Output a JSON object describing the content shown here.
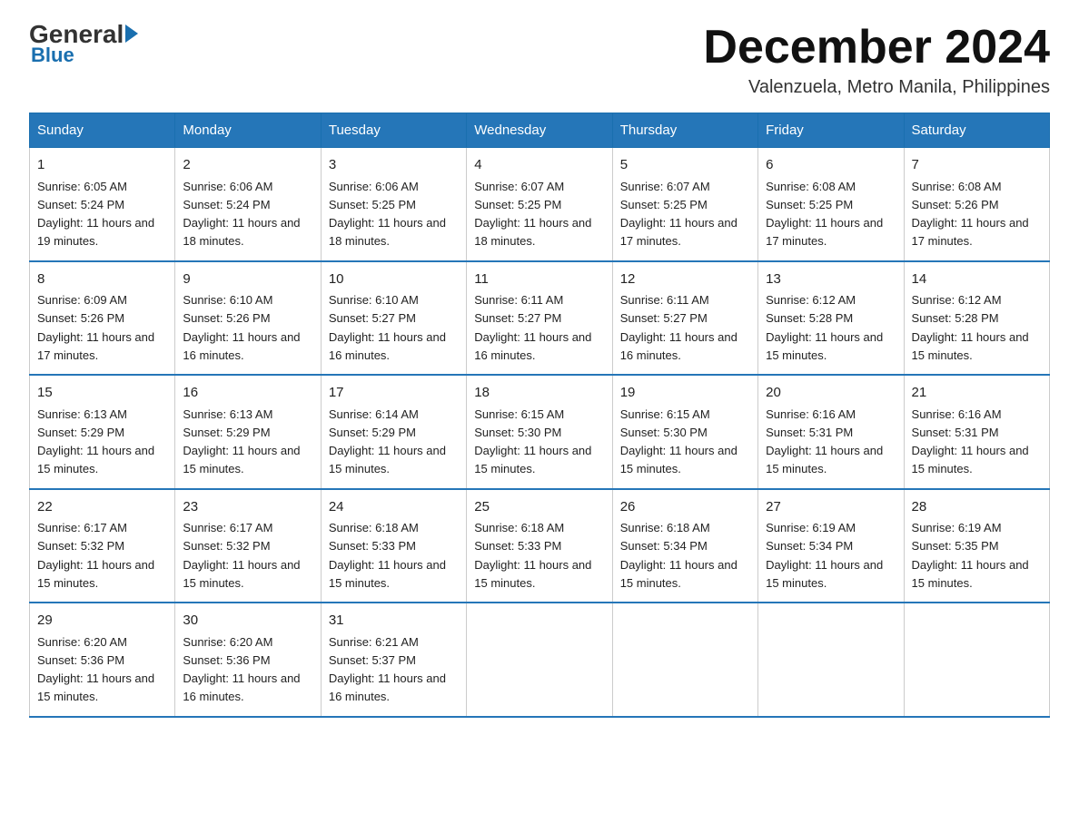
{
  "logo": {
    "general": "General",
    "arrow": "",
    "blue": "Blue"
  },
  "header": {
    "month_title": "December 2024",
    "location": "Valenzuela, Metro Manila, Philippines"
  },
  "weekdays": [
    "Sunday",
    "Monday",
    "Tuesday",
    "Wednesday",
    "Thursday",
    "Friday",
    "Saturday"
  ],
  "weeks": [
    [
      {
        "day": "1",
        "sunrise": "6:05 AM",
        "sunset": "5:24 PM",
        "daylight": "11 hours and 19 minutes."
      },
      {
        "day": "2",
        "sunrise": "6:06 AM",
        "sunset": "5:24 PM",
        "daylight": "11 hours and 18 minutes."
      },
      {
        "day": "3",
        "sunrise": "6:06 AM",
        "sunset": "5:25 PM",
        "daylight": "11 hours and 18 minutes."
      },
      {
        "day": "4",
        "sunrise": "6:07 AM",
        "sunset": "5:25 PM",
        "daylight": "11 hours and 18 minutes."
      },
      {
        "day": "5",
        "sunrise": "6:07 AM",
        "sunset": "5:25 PM",
        "daylight": "11 hours and 17 minutes."
      },
      {
        "day": "6",
        "sunrise": "6:08 AM",
        "sunset": "5:25 PM",
        "daylight": "11 hours and 17 minutes."
      },
      {
        "day": "7",
        "sunrise": "6:08 AM",
        "sunset": "5:26 PM",
        "daylight": "11 hours and 17 minutes."
      }
    ],
    [
      {
        "day": "8",
        "sunrise": "6:09 AM",
        "sunset": "5:26 PM",
        "daylight": "11 hours and 17 minutes."
      },
      {
        "day": "9",
        "sunrise": "6:10 AM",
        "sunset": "5:26 PM",
        "daylight": "11 hours and 16 minutes."
      },
      {
        "day": "10",
        "sunrise": "6:10 AM",
        "sunset": "5:27 PM",
        "daylight": "11 hours and 16 minutes."
      },
      {
        "day": "11",
        "sunrise": "6:11 AM",
        "sunset": "5:27 PM",
        "daylight": "11 hours and 16 minutes."
      },
      {
        "day": "12",
        "sunrise": "6:11 AM",
        "sunset": "5:27 PM",
        "daylight": "11 hours and 16 minutes."
      },
      {
        "day": "13",
        "sunrise": "6:12 AM",
        "sunset": "5:28 PM",
        "daylight": "11 hours and 15 minutes."
      },
      {
        "day": "14",
        "sunrise": "6:12 AM",
        "sunset": "5:28 PM",
        "daylight": "11 hours and 15 minutes."
      }
    ],
    [
      {
        "day": "15",
        "sunrise": "6:13 AM",
        "sunset": "5:29 PM",
        "daylight": "11 hours and 15 minutes."
      },
      {
        "day": "16",
        "sunrise": "6:13 AM",
        "sunset": "5:29 PM",
        "daylight": "11 hours and 15 minutes."
      },
      {
        "day": "17",
        "sunrise": "6:14 AM",
        "sunset": "5:29 PM",
        "daylight": "11 hours and 15 minutes."
      },
      {
        "day": "18",
        "sunrise": "6:15 AM",
        "sunset": "5:30 PM",
        "daylight": "11 hours and 15 minutes."
      },
      {
        "day": "19",
        "sunrise": "6:15 AM",
        "sunset": "5:30 PM",
        "daylight": "11 hours and 15 minutes."
      },
      {
        "day": "20",
        "sunrise": "6:16 AM",
        "sunset": "5:31 PM",
        "daylight": "11 hours and 15 minutes."
      },
      {
        "day": "21",
        "sunrise": "6:16 AM",
        "sunset": "5:31 PM",
        "daylight": "11 hours and 15 minutes."
      }
    ],
    [
      {
        "day": "22",
        "sunrise": "6:17 AM",
        "sunset": "5:32 PM",
        "daylight": "11 hours and 15 minutes."
      },
      {
        "day": "23",
        "sunrise": "6:17 AM",
        "sunset": "5:32 PM",
        "daylight": "11 hours and 15 minutes."
      },
      {
        "day": "24",
        "sunrise": "6:18 AM",
        "sunset": "5:33 PM",
        "daylight": "11 hours and 15 minutes."
      },
      {
        "day": "25",
        "sunrise": "6:18 AM",
        "sunset": "5:33 PM",
        "daylight": "11 hours and 15 minutes."
      },
      {
        "day": "26",
        "sunrise": "6:18 AM",
        "sunset": "5:34 PM",
        "daylight": "11 hours and 15 minutes."
      },
      {
        "day": "27",
        "sunrise": "6:19 AM",
        "sunset": "5:34 PM",
        "daylight": "11 hours and 15 minutes."
      },
      {
        "day": "28",
        "sunrise": "6:19 AM",
        "sunset": "5:35 PM",
        "daylight": "11 hours and 15 minutes."
      }
    ],
    [
      {
        "day": "29",
        "sunrise": "6:20 AM",
        "sunset": "5:36 PM",
        "daylight": "11 hours and 15 minutes."
      },
      {
        "day": "30",
        "sunrise": "6:20 AM",
        "sunset": "5:36 PM",
        "daylight": "11 hours and 16 minutes."
      },
      {
        "day": "31",
        "sunrise": "6:21 AM",
        "sunset": "5:37 PM",
        "daylight": "11 hours and 16 minutes."
      },
      {
        "day": "",
        "sunrise": "",
        "sunset": "",
        "daylight": ""
      },
      {
        "day": "",
        "sunrise": "",
        "sunset": "",
        "daylight": ""
      },
      {
        "day": "",
        "sunrise": "",
        "sunset": "",
        "daylight": ""
      },
      {
        "day": "",
        "sunrise": "",
        "sunset": "",
        "daylight": ""
      }
    ]
  ]
}
